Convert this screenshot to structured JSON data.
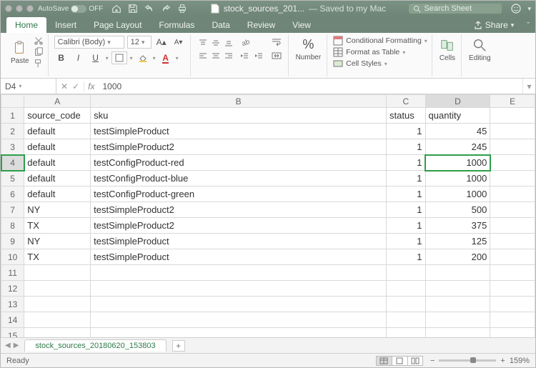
{
  "titlebar": {
    "autosave_label": "AutoSave",
    "autosave_state": "OFF",
    "filename": "stock_sources_201...",
    "saved_text": "— Saved to my Mac",
    "search_placeholder": "Search Sheet"
  },
  "tabs": {
    "items": [
      "Home",
      "Insert",
      "Page Layout",
      "Formulas",
      "Data",
      "Review",
      "View"
    ],
    "active": "Home",
    "share": "Share"
  },
  "ribbon": {
    "paste": "Paste",
    "font_name": "Calibri (Body)",
    "font_size": "12",
    "number_label": "Number",
    "percent": "%",
    "cond_fmt": "Conditional Formatting",
    "fmt_table": "Format as Table",
    "cell_styles": "Cell Styles",
    "cells": "Cells",
    "editing": "Editing"
  },
  "formula_bar": {
    "name_box": "D4",
    "fx": "fx",
    "value": "1000"
  },
  "columns": [
    "A",
    "B",
    "C",
    "D",
    "E"
  ],
  "header_row": {
    "A": "source_code",
    "B": "sku",
    "C": "status",
    "D": "quantity"
  },
  "rows": [
    {
      "A": "default",
      "B": "testSimpleProduct",
      "C": 1,
      "D": 45
    },
    {
      "A": "default",
      "B": "testSimpleProduct2",
      "C": 1,
      "D": 245
    },
    {
      "A": "default",
      "B": "testConfigProduct-red",
      "C": 1,
      "D": 1000
    },
    {
      "A": "default",
      "B": "testConfigProduct-blue",
      "C": 1,
      "D": 1000
    },
    {
      "A": "default",
      "B": "testConfigProduct-green",
      "C": 1,
      "D": 1000
    },
    {
      "A": "NY",
      "B": "testSimpleProduct2",
      "C": 1,
      "D": 500
    },
    {
      "A": "TX",
      "B": "testSimpleProduct2",
      "C": 1,
      "D": 375
    },
    {
      "A": "NY",
      "B": "testSimpleProduct",
      "C": 1,
      "D": 125
    },
    {
      "A": "TX",
      "B": "testSimpleProduct",
      "C": 1,
      "D": 200
    }
  ],
  "selected_cell": "D4",
  "sheet_tab": "stock_sources_20180620_153803",
  "status": {
    "ready": "Ready",
    "zoom": "159%"
  }
}
